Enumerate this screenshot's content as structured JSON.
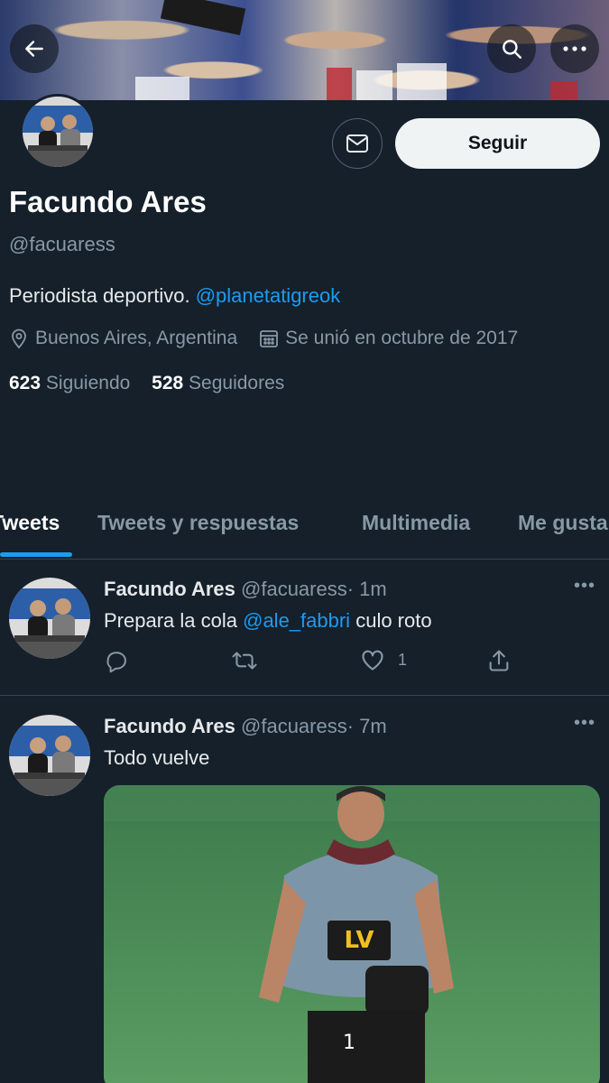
{
  "header": {
    "back_icon": "arrow-left-icon",
    "search_icon": "search-icon",
    "more_icon": "more-horizontal-icon"
  },
  "profile": {
    "name": "Facundo Ares",
    "handle": "@facuaress",
    "bio_text": "Periodista deportivo.",
    "bio_link": "@planetatigreok",
    "location": "Buenos Aires, Argentina",
    "joined": "Se unió en octubre de 2017",
    "following_count": "623",
    "following_label": "Siguiendo",
    "followers_count": "528",
    "followers_label": "Seguidores",
    "follow_button": "Seguir",
    "message_icon": "envelope-icon"
  },
  "tabs": [
    {
      "label": "Tweets",
      "active": true
    },
    {
      "label": "Tweets y respuestas",
      "active": false
    },
    {
      "label": "Multimedia",
      "active": false
    },
    {
      "label": "Me gusta",
      "active": false
    }
  ],
  "tweets": [
    {
      "name": "Facundo Ares",
      "handle": "@facuaress",
      "time": "· 1m",
      "text_before": "Prepara la cola",
      "mention": "@ale_fabbri",
      "text_after": "culo roto",
      "likes": "1"
    },
    {
      "name": "Facundo Ares",
      "handle": "@facuaress",
      "time": "· 7m",
      "text": "Todo vuelve",
      "jersey_text": "LV",
      "jersey_number": "1"
    }
  ],
  "colors": {
    "background": "#15202b",
    "accent": "#1d9bf0",
    "secondary_text": "#8899a6"
  }
}
